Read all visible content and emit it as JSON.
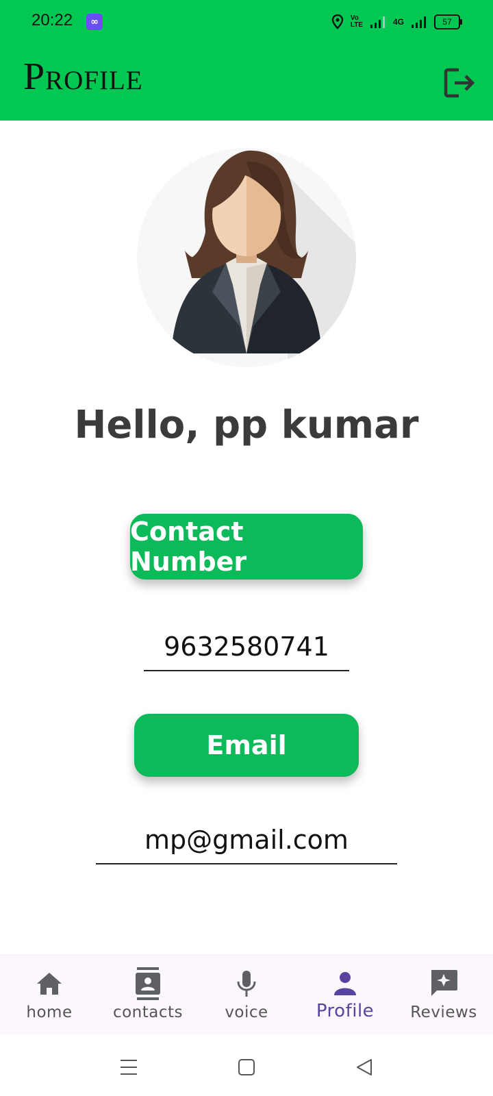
{
  "status_bar": {
    "time": "20:22",
    "app_icon": "infinity-icon",
    "battery": "57",
    "network_label": "4G",
    "volte_label": "VoLTE"
  },
  "app_bar": {
    "title": "Profile",
    "logout_icon": "logout-icon",
    "background_color": "#00c853"
  },
  "profile": {
    "avatar": "avatar-woman-icon",
    "greeting": "Hello, pp kumar",
    "contact_label": "Contact Number",
    "contact_value": "9632580741",
    "email_label": "Email",
    "email_value": "mp@gmail.com",
    "accent_color": "#0dba5a"
  },
  "bottom_nav": {
    "items": [
      {
        "label": "home",
        "icon": "home-icon",
        "active": false
      },
      {
        "label": "contacts",
        "icon": "contacts-icon",
        "active": false
      },
      {
        "label": "voice",
        "icon": "microphone-icon",
        "active": false
      },
      {
        "label": "Profile",
        "icon": "person-icon",
        "active": true
      },
      {
        "label": "Reviews",
        "icon": "reviews-icon",
        "active": false
      }
    ],
    "active_color": "#5a43a0"
  },
  "system_nav": {
    "items": [
      "menu-icon",
      "home-square-icon",
      "back-triangle-icon"
    ]
  }
}
